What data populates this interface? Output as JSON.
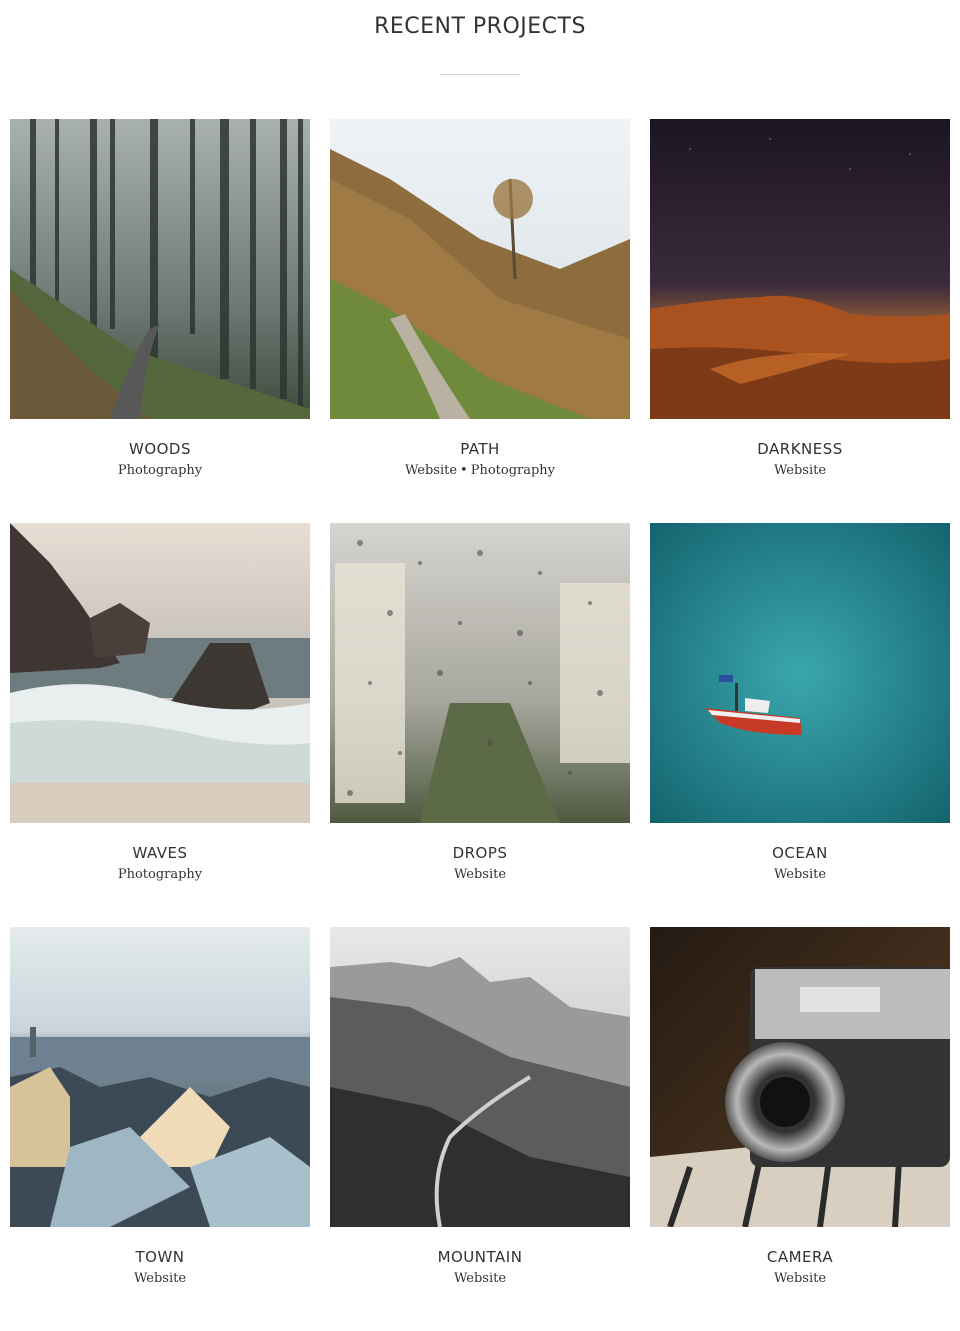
{
  "header": {
    "title": "RECENT PROJECTS"
  },
  "projects": [
    {
      "title": "WOODS",
      "categories": [
        "Photography"
      ],
      "image": "misty-forest-path"
    },
    {
      "title": "PATH",
      "categories": [
        "Website",
        "Photography"
      ],
      "image": "autumn-mountain-path"
    },
    {
      "title": "DARKNESS",
      "categories": [
        "Website"
      ],
      "image": "desert-dune-night"
    },
    {
      "title": "WAVES",
      "categories": [
        "Photography"
      ],
      "image": "rocky-beach-waves"
    },
    {
      "title": "DROPS",
      "categories": [
        "Website"
      ],
      "image": "raindrops-window-city"
    },
    {
      "title": "OCEAN",
      "categories": [
        "Website"
      ],
      "image": "red-boat-turquoise-sea"
    },
    {
      "title": "TOWN",
      "categories": [
        "Website"
      ],
      "image": "snowy-town-rooftops"
    },
    {
      "title": "MOUNTAIN",
      "categories": [
        "Website"
      ],
      "image": "bw-mountain-trail"
    },
    {
      "title": "CAMERA",
      "categories": [
        "Website"
      ],
      "image": "vintage-camera"
    }
  ],
  "separator": "•"
}
